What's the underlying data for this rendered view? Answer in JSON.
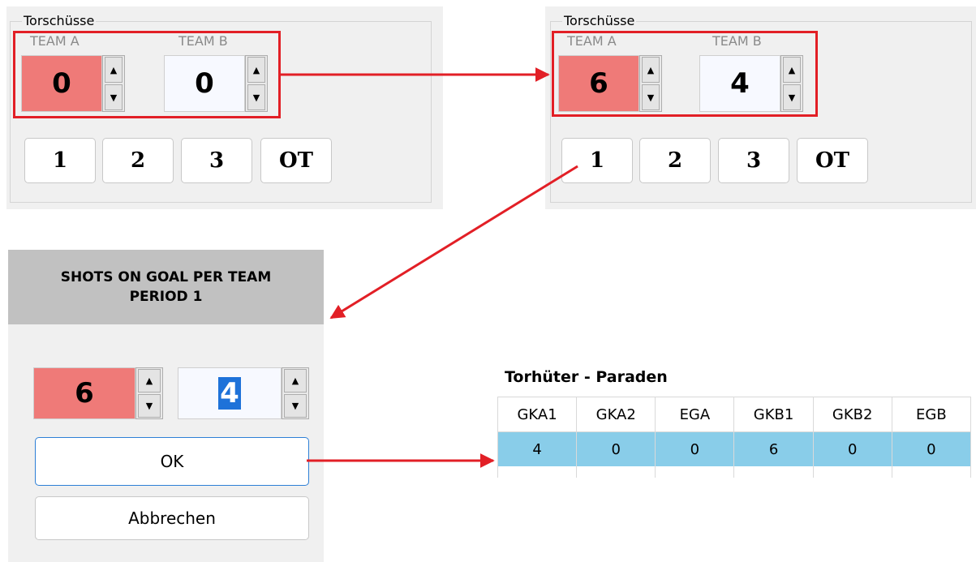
{
  "panel_left": {
    "group_title": "Torschüsse",
    "team_a_label": "TEAM A",
    "team_b_label": "TEAM B",
    "team_a_value": "0",
    "team_b_value": "0",
    "periods": [
      "1",
      "2",
      "3",
      "OT"
    ]
  },
  "panel_right": {
    "group_title": "Torschüsse",
    "team_a_label": "TEAM A",
    "team_b_label": "TEAM B",
    "team_a_value": "6",
    "team_b_value": "4",
    "periods": [
      "1",
      "2",
      "3",
      "OT"
    ]
  },
  "dialog": {
    "title_line1": "SHOTS ON GOAL PER TEAM",
    "title_line2": "PERIOD 1",
    "team_a_value": "6",
    "team_b_value": "4",
    "ok_label": "OK",
    "cancel_label": "Abbrechen"
  },
  "saves_table": {
    "title": "Torhüter - Paraden",
    "headers": [
      "GKA1",
      "GKA2",
      "EGA",
      "GKB1",
      "GKB2",
      "EGB"
    ],
    "row": [
      "4",
      "0",
      "0",
      "6",
      "0",
      "0"
    ]
  },
  "icons": {
    "spin_up": "▲",
    "spin_down": "▼"
  },
  "colors": {
    "team_a_bg": "#ef7a78",
    "highlight_red": "#e21f26",
    "selected_row": "#89cde9"
  }
}
